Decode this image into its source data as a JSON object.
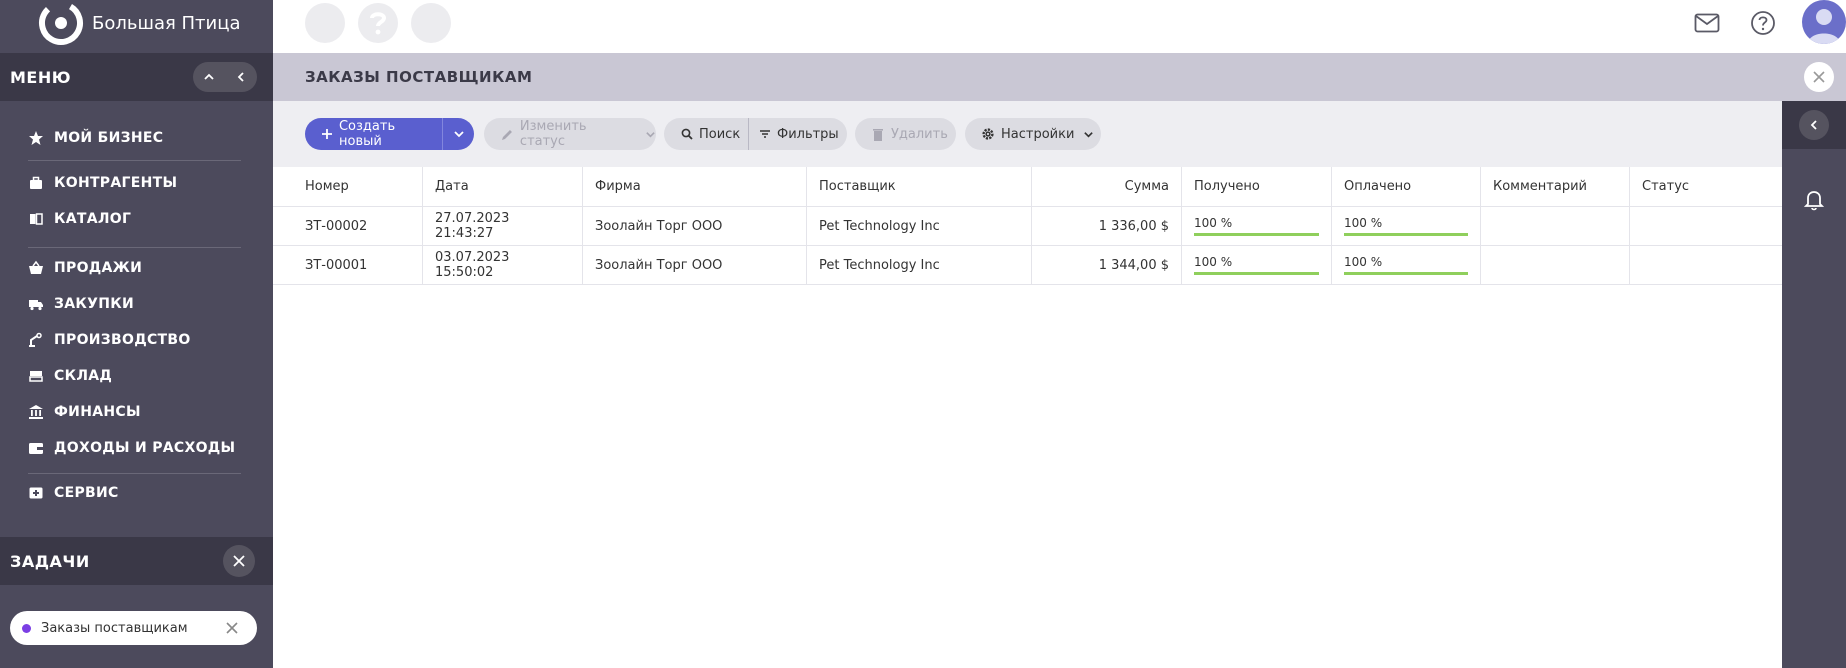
{
  "app": {
    "logo_text": "Большая Птица"
  },
  "menu": {
    "title": "МЕНЮ",
    "items": [
      {
        "label": "МОЙ БИЗНЕС",
        "icon": "star-icon"
      },
      {
        "label": "КОНТРАГЕНТЫ",
        "icon": "briefcase-icon"
      },
      {
        "label": "КАТАЛОГ",
        "icon": "book-icon"
      },
      {
        "label": "ПРОДАЖИ",
        "icon": "basket-icon"
      },
      {
        "label": "ЗАКУПКИ",
        "icon": "truck-icon"
      },
      {
        "label": "ПРОИЗВОДСТВО",
        "icon": "robot-arm-icon"
      },
      {
        "label": "СКЛАД",
        "icon": "warehouse-icon"
      },
      {
        "label": "ФИНАНСЫ",
        "icon": "bank-icon"
      },
      {
        "label": "ДОХОДЫ И РАСХОДЫ",
        "icon": "wallet-icon"
      },
      {
        "label": "СЕРВИС",
        "icon": "service-icon"
      }
    ]
  },
  "tasks": {
    "title": "ЗАДАЧИ",
    "items": [
      {
        "label": "Заказы поставщикам"
      }
    ]
  },
  "page": {
    "title": "ЗАКАЗЫ ПОСТАВЩИКАМ"
  },
  "toolbar": {
    "create_label": "Создать новый",
    "change_status_label": "Изменить статус",
    "search_label": "Поиск",
    "filters_label": "Фильтры",
    "delete_label": "Удалить",
    "settings_label": "Настройки"
  },
  "table": {
    "columns": [
      "Номер",
      "Дата",
      "Фирма",
      "Поставщик",
      "Сумма",
      "Получено",
      "Оплачено",
      "Комментарий",
      "Статус"
    ],
    "rows": [
      {
        "number": "ЗТ-00002",
        "date": "27.07.2023 21:43:27",
        "firm": "Зоолайн Торг ООО",
        "supplier": "Pet Technology Inc",
        "sum": "1 336,00 $",
        "received": "100 %",
        "received_value": 100,
        "paid": "100 %",
        "paid_value": 100,
        "comment": "",
        "status": ""
      },
      {
        "number": "ЗТ-00001",
        "date": "03.07.2023 15:50:02",
        "firm": "Зоолайн Торг ООО",
        "supplier": "Pet Technology Inc",
        "sum": "1 344,00 $",
        "received": "100 %",
        "received_value": 100,
        "paid": "100 %",
        "paid_value": 100,
        "comment": "",
        "status": ""
      }
    ]
  },
  "colors": {
    "sidebar_bg": "#4c4a5c",
    "primary": "#5a5fcf",
    "progress": "#8fcf5c",
    "task_dot": "#7b3fe4"
  }
}
